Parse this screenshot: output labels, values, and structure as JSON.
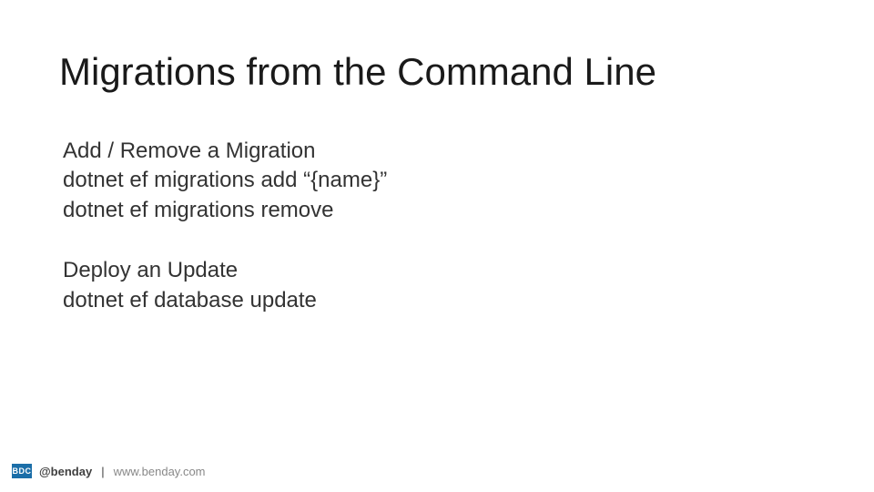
{
  "title": "Migrations from the Command Line",
  "section1": {
    "heading": "Add / Remove a Migration",
    "line1": "dotnet ef migrations add “{name}”",
    "line2": "dotnet ef migrations remove"
  },
  "section2": {
    "heading": "Deploy an Update",
    "line1": "dotnet ef database update"
  },
  "footer": {
    "logo": "BDC",
    "handle": "@benday",
    "separator": "|",
    "url": "www.benday.com"
  }
}
